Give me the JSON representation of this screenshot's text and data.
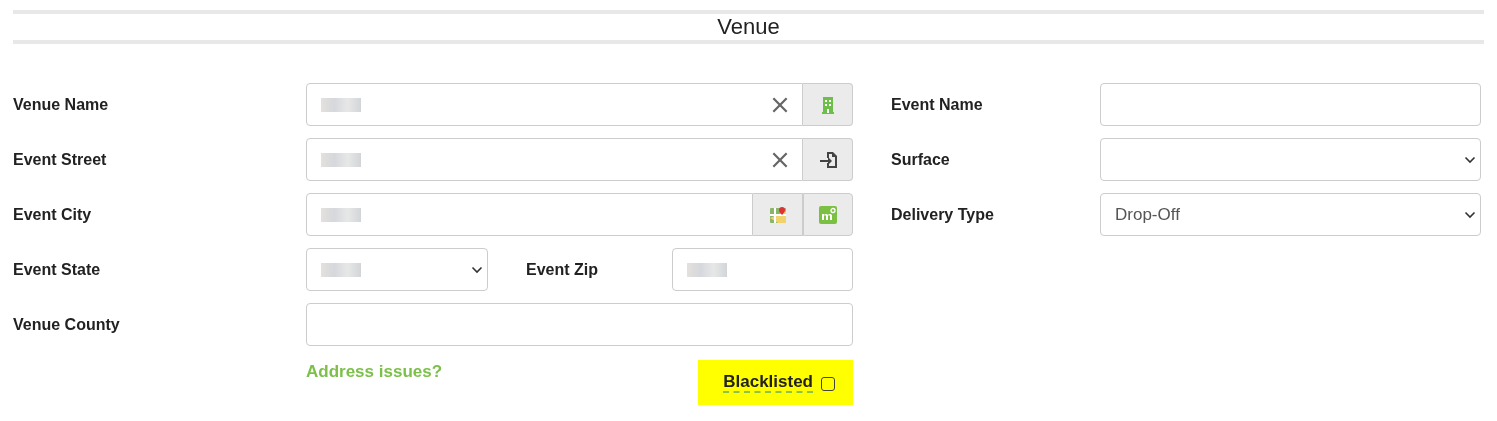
{
  "section": {
    "title": "Venue"
  },
  "left_rows": [
    {
      "label": "Venue Name",
      "control": {
        "kind": "text",
        "redacted": true,
        "addons": [
          {
            "kind": "clear"
          },
          {
            "kind": "building"
          }
        ]
      }
    },
    {
      "label": "Event Street",
      "control": {
        "kind": "text",
        "redacted": true,
        "addons": [
          {
            "kind": "clear"
          },
          {
            "kind": "import"
          }
        ]
      }
    },
    {
      "label": "Event City",
      "control": {
        "kind": "text",
        "redacted": true,
        "addons": [
          {
            "kind": "map"
          },
          {
            "kind": "mq"
          }
        ]
      }
    },
    {
      "label": "Event State",
      "control": {
        "kind": "select",
        "redacted": true
      },
      "extra": {
        "label": "Event Zip",
        "control": {
          "kind": "text",
          "redacted": true
        }
      }
    },
    {
      "label": "Venue County",
      "control": {
        "kind": "text",
        "redacted": false
      }
    }
  ],
  "right_rows": [
    {
      "label": "Event Name",
      "control": {
        "kind": "text",
        "redacted": false
      }
    },
    {
      "label": "Surface",
      "control": {
        "kind": "select",
        "redacted": false
      }
    },
    {
      "label": "Delivery Type",
      "control": {
        "kind": "select",
        "value": "Drop-Off",
        "redacted": false
      }
    }
  ],
  "address_link": "Address issues?",
  "blacklisted": {
    "label": "Blacklisted",
    "checked": false
  }
}
